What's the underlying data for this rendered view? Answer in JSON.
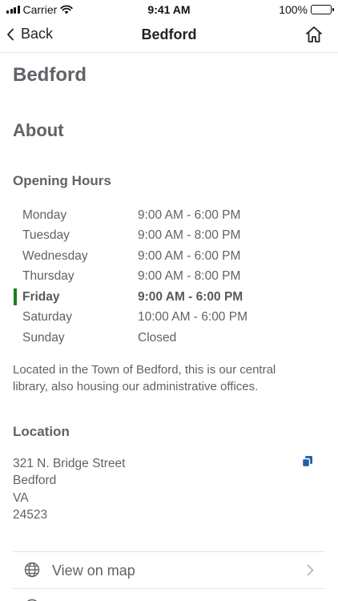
{
  "status_bar": {
    "carrier": "Carrier",
    "time": "9:41 AM",
    "battery": "100%",
    "battery_level": 1.0
  },
  "nav": {
    "back_label": "Back",
    "title": "Bedford",
    "home_icon": "home-icon"
  },
  "page": {
    "title": "Bedford",
    "about_heading": "About",
    "hours_heading": "Opening Hours",
    "hours": [
      {
        "day": "Monday",
        "time": "9:00 AM - 6:00 PM"
      },
      {
        "day": "Tuesday",
        "time": "9:00 AM - 8:00 PM"
      },
      {
        "day": "Wednesday",
        "time": "9:00 AM - 6:00 PM"
      },
      {
        "day": "Thursday",
        "time": "9:00 AM - 8:00 PM"
      },
      {
        "day": "Friday",
        "time": "9:00 AM - 6:00 PM"
      },
      {
        "day": "Saturday",
        "time": "10:00 AM - 6:00 PM"
      },
      {
        "day": "Sunday",
        "time": "Closed"
      }
    ],
    "current_day_index": 4,
    "current_day_color": "#1a7f1a",
    "description": "Located in the Town of Bedford, this is our central library, also housing our administrative offices.",
    "location_heading": "Location",
    "address": [
      "321 N. Bridge Street",
      "Bedford",
      "VA",
      "24523"
    ],
    "copy_icon": "copy-icon",
    "accent_color": "#1f5fa8",
    "actions": [
      {
        "label": "View on map",
        "icon": "globe-icon"
      }
    ]
  }
}
